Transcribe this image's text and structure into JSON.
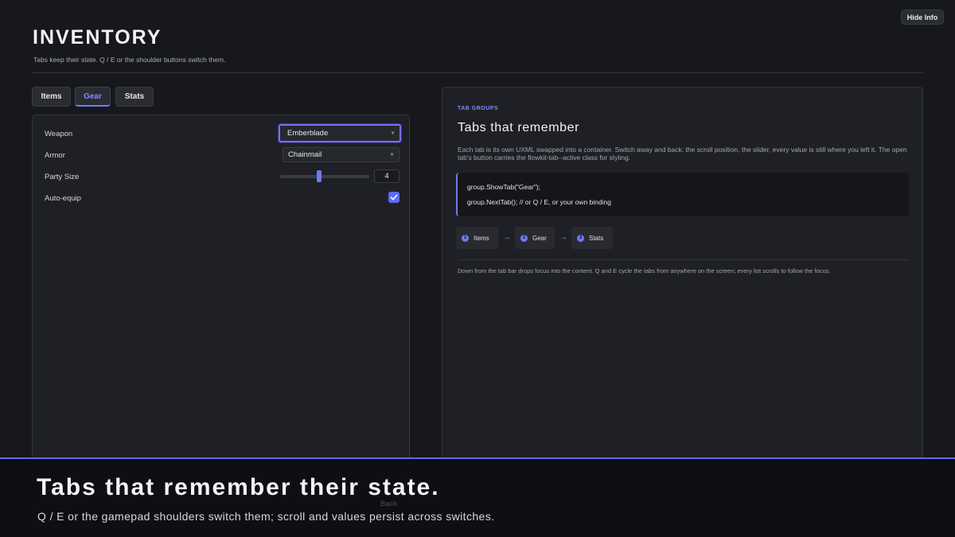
{
  "hide_info_label": "Hide Info",
  "header": {
    "title": "INVENTORY",
    "subtitle": "Tabs keep their state. Q / E or the shoulder buttons switch them."
  },
  "tabs": [
    {
      "label": "Items",
      "active": false
    },
    {
      "label": "Gear",
      "active": true
    },
    {
      "label": "Stats",
      "active": false
    }
  ],
  "gear_form": {
    "weapon": {
      "label": "Weapon",
      "value": "Emberblade"
    },
    "armor": {
      "label": "Armor",
      "value": "Chainmail"
    },
    "party_size": {
      "label": "Party Size",
      "value": "4",
      "slider_fraction": 0.43
    },
    "auto_equip": {
      "label": "Auto-equip",
      "checked": true
    }
  },
  "info_panel": {
    "eyebrow": "TAB GROUPS",
    "title": "Tabs that remember",
    "description": "Each tab is its own UXML swapped into a container. Switch away and back: the scroll position, the slider, every value is still where you left it. The open tab's button carries the flowkit-tab--active class for styling.",
    "code": [
      "group.ShowTab(\"Gear\");",
      "group.NextTab(); // or Q / E, or your own binding"
    ],
    "steps": [
      {
        "num": "1",
        "label": "Items"
      },
      {
        "num": "2",
        "label": "Gear"
      },
      {
        "num": "3",
        "label": "Stats"
      }
    ],
    "footer": "Down from the tab bar drops focus into the content. Q and E cycle the tabs from anywhere on the screen; every list scrolls to follow the focus."
  },
  "overlay": {
    "title": "Tabs that remember their state.",
    "subtitle": "Q / E or the gamepad shoulders switch them; scroll and values persist across switches.",
    "back_label": "Back"
  },
  "colors": {
    "accent": "#6c7cff",
    "background": "#17181c",
    "panel": "#1f2025"
  }
}
